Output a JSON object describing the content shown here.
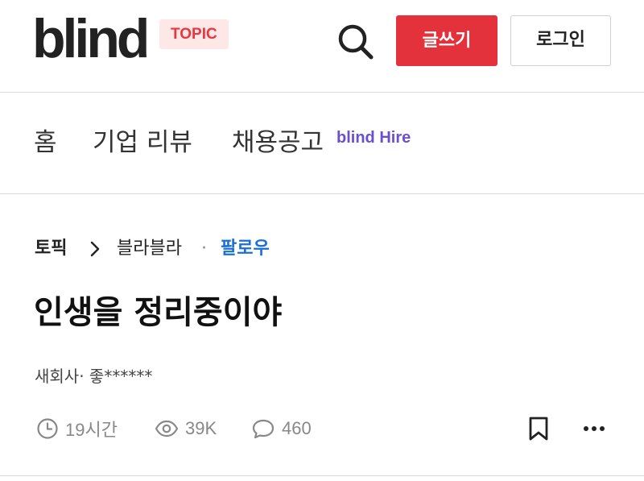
{
  "header": {
    "logo_text": "blind",
    "topic_badge": "TOPIC",
    "search_icon": "search-icon",
    "write_label": "글쓰기",
    "login_label": "로그인",
    "accent_color": "#e3323c"
  },
  "nav": {
    "items": [
      {
        "label": "홈"
      },
      {
        "label": "기업 리뷰"
      },
      {
        "label": "채용공고"
      }
    ],
    "hire_badge": "blind Hire"
  },
  "post": {
    "breadcrumb": {
      "topic": "토픽",
      "board": "블라블라",
      "separator": "·",
      "follow_label": "팔로우"
    },
    "title": "인생을 정리중이야",
    "author": "새회사· 좋******",
    "meta": {
      "time": "19시간",
      "views": "39K",
      "comments": "460"
    },
    "actions": {
      "bookmark_icon": "bookmark-icon",
      "more_icon": "more-icon"
    }
  }
}
